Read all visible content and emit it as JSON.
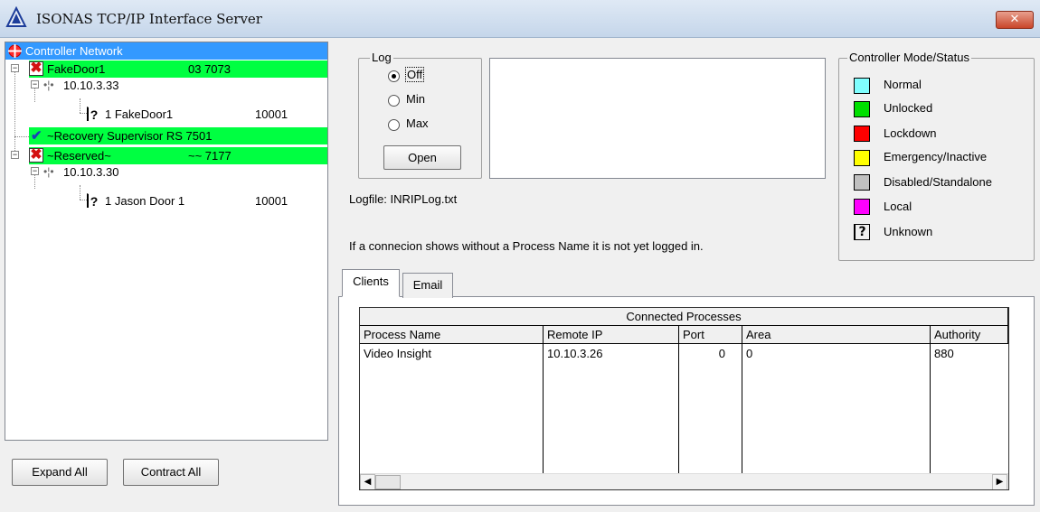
{
  "window": {
    "title": "ISONAS TCP/IP Interface Server",
    "close_glyph": "x"
  },
  "tree": {
    "root": "Controller Network",
    "nodes": [
      {
        "name": "FakeDoor1",
        "info": "03 7073",
        "status": "x"
      },
      {
        "ip": "10.10.3.33"
      },
      {
        "reader": "1 FakeDoor1",
        "port": "10001",
        "status": "?"
      },
      {
        "name": "~Recovery Supervisor RS 7501",
        "status": "check"
      },
      {
        "name": "~Reserved~",
        "info": "~~ 7177",
        "status": "x"
      },
      {
        "ip": "10.10.3.30"
      },
      {
        "reader": "1 Jason Door 1",
        "port": "10001",
        "status": "?"
      }
    ],
    "expand_all_label": "Expand All",
    "contract_all_label": "Contract All"
  },
  "log": {
    "group_label": "Log",
    "options": [
      {
        "label": "Off",
        "selected": true
      },
      {
        "label": "Min",
        "selected": false
      },
      {
        "label": "Max",
        "selected": false
      }
    ],
    "open_label": "Open",
    "logfile_text": "Logfile: INRIPLog.txt",
    "note": "If a connecion shows without a Process Name it is not yet logged in."
  },
  "status_legend": {
    "title": "Controller Mode/Status",
    "items": [
      {
        "label": "Normal",
        "color": "#80ffff"
      },
      {
        "label": "Unlocked",
        "color": "#00e000"
      },
      {
        "label": "Lockdown",
        "color": "#ff0000"
      },
      {
        "label": "Emergency/Inactive",
        "color": "#ffff00"
      },
      {
        "label": "Disabled/Standalone",
        "color": "#c0c0c0"
      },
      {
        "label": "Local",
        "color": "#ff00ff"
      },
      {
        "label": "Unknown",
        "glyph": "?"
      }
    ]
  },
  "tabs": [
    {
      "label": "Clients",
      "active": true
    },
    {
      "label": "Email",
      "active": false
    }
  ],
  "clients_grid": {
    "caption": "Connected Processes",
    "columns": [
      "Process Name",
      "Remote IP",
      "Port",
      "Area",
      "Authority"
    ],
    "rows": [
      [
        "Video Insight",
        "10.10.3.26",
        "0",
        "0",
        "880"
      ]
    ]
  }
}
